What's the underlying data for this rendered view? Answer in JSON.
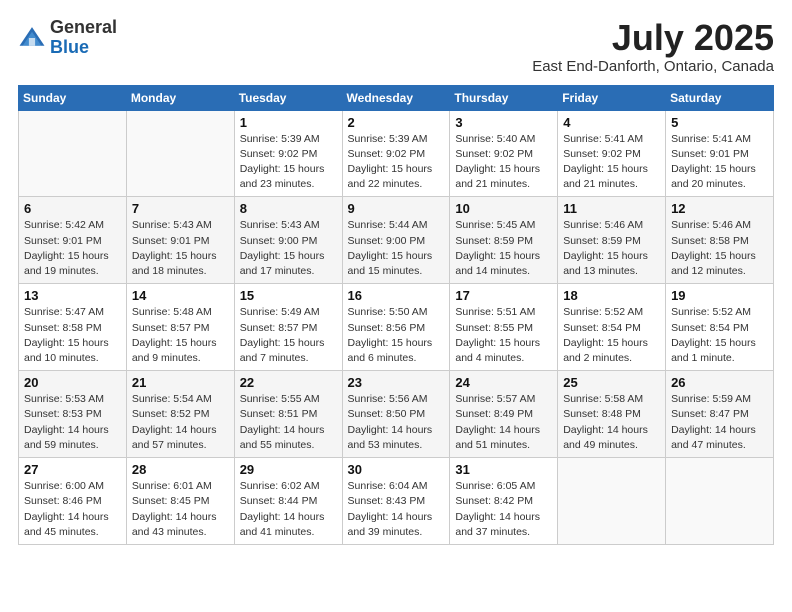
{
  "logo": {
    "general": "General",
    "blue": "Blue"
  },
  "title": "July 2025",
  "subtitle": "East End-Danforth, Ontario, Canada",
  "weekdays": [
    "Sunday",
    "Monday",
    "Tuesday",
    "Wednesday",
    "Thursday",
    "Friday",
    "Saturday"
  ],
  "weeks": [
    [
      {
        "day": "",
        "sunrise": "",
        "sunset": "",
        "daylight": ""
      },
      {
        "day": "",
        "sunrise": "",
        "sunset": "",
        "daylight": ""
      },
      {
        "day": "1",
        "sunrise": "Sunrise: 5:39 AM",
        "sunset": "Sunset: 9:02 PM",
        "daylight": "Daylight: 15 hours and 23 minutes."
      },
      {
        "day": "2",
        "sunrise": "Sunrise: 5:39 AM",
        "sunset": "Sunset: 9:02 PM",
        "daylight": "Daylight: 15 hours and 22 minutes."
      },
      {
        "day": "3",
        "sunrise": "Sunrise: 5:40 AM",
        "sunset": "Sunset: 9:02 PM",
        "daylight": "Daylight: 15 hours and 21 minutes."
      },
      {
        "day": "4",
        "sunrise": "Sunrise: 5:41 AM",
        "sunset": "Sunset: 9:02 PM",
        "daylight": "Daylight: 15 hours and 21 minutes."
      },
      {
        "day": "5",
        "sunrise": "Sunrise: 5:41 AM",
        "sunset": "Sunset: 9:01 PM",
        "daylight": "Daylight: 15 hours and 20 minutes."
      }
    ],
    [
      {
        "day": "6",
        "sunrise": "Sunrise: 5:42 AM",
        "sunset": "Sunset: 9:01 PM",
        "daylight": "Daylight: 15 hours and 19 minutes."
      },
      {
        "day": "7",
        "sunrise": "Sunrise: 5:43 AM",
        "sunset": "Sunset: 9:01 PM",
        "daylight": "Daylight: 15 hours and 18 minutes."
      },
      {
        "day": "8",
        "sunrise": "Sunrise: 5:43 AM",
        "sunset": "Sunset: 9:00 PM",
        "daylight": "Daylight: 15 hours and 17 minutes."
      },
      {
        "day": "9",
        "sunrise": "Sunrise: 5:44 AM",
        "sunset": "Sunset: 9:00 PM",
        "daylight": "Daylight: 15 hours and 15 minutes."
      },
      {
        "day": "10",
        "sunrise": "Sunrise: 5:45 AM",
        "sunset": "Sunset: 8:59 PM",
        "daylight": "Daylight: 15 hours and 14 minutes."
      },
      {
        "day": "11",
        "sunrise": "Sunrise: 5:46 AM",
        "sunset": "Sunset: 8:59 PM",
        "daylight": "Daylight: 15 hours and 13 minutes."
      },
      {
        "day": "12",
        "sunrise": "Sunrise: 5:46 AM",
        "sunset": "Sunset: 8:58 PM",
        "daylight": "Daylight: 15 hours and 12 minutes."
      }
    ],
    [
      {
        "day": "13",
        "sunrise": "Sunrise: 5:47 AM",
        "sunset": "Sunset: 8:58 PM",
        "daylight": "Daylight: 15 hours and 10 minutes."
      },
      {
        "day": "14",
        "sunrise": "Sunrise: 5:48 AM",
        "sunset": "Sunset: 8:57 PM",
        "daylight": "Daylight: 15 hours and 9 minutes."
      },
      {
        "day": "15",
        "sunrise": "Sunrise: 5:49 AM",
        "sunset": "Sunset: 8:57 PM",
        "daylight": "Daylight: 15 hours and 7 minutes."
      },
      {
        "day": "16",
        "sunrise": "Sunrise: 5:50 AM",
        "sunset": "Sunset: 8:56 PM",
        "daylight": "Daylight: 15 hours and 6 minutes."
      },
      {
        "day": "17",
        "sunrise": "Sunrise: 5:51 AM",
        "sunset": "Sunset: 8:55 PM",
        "daylight": "Daylight: 15 hours and 4 minutes."
      },
      {
        "day": "18",
        "sunrise": "Sunrise: 5:52 AM",
        "sunset": "Sunset: 8:54 PM",
        "daylight": "Daylight: 15 hours and 2 minutes."
      },
      {
        "day": "19",
        "sunrise": "Sunrise: 5:52 AM",
        "sunset": "Sunset: 8:54 PM",
        "daylight": "Daylight: 15 hours and 1 minute."
      }
    ],
    [
      {
        "day": "20",
        "sunrise": "Sunrise: 5:53 AM",
        "sunset": "Sunset: 8:53 PM",
        "daylight": "Daylight: 14 hours and 59 minutes."
      },
      {
        "day": "21",
        "sunrise": "Sunrise: 5:54 AM",
        "sunset": "Sunset: 8:52 PM",
        "daylight": "Daylight: 14 hours and 57 minutes."
      },
      {
        "day": "22",
        "sunrise": "Sunrise: 5:55 AM",
        "sunset": "Sunset: 8:51 PM",
        "daylight": "Daylight: 14 hours and 55 minutes."
      },
      {
        "day": "23",
        "sunrise": "Sunrise: 5:56 AM",
        "sunset": "Sunset: 8:50 PM",
        "daylight": "Daylight: 14 hours and 53 minutes."
      },
      {
        "day": "24",
        "sunrise": "Sunrise: 5:57 AM",
        "sunset": "Sunset: 8:49 PM",
        "daylight": "Daylight: 14 hours and 51 minutes."
      },
      {
        "day": "25",
        "sunrise": "Sunrise: 5:58 AM",
        "sunset": "Sunset: 8:48 PM",
        "daylight": "Daylight: 14 hours and 49 minutes."
      },
      {
        "day": "26",
        "sunrise": "Sunrise: 5:59 AM",
        "sunset": "Sunset: 8:47 PM",
        "daylight": "Daylight: 14 hours and 47 minutes."
      }
    ],
    [
      {
        "day": "27",
        "sunrise": "Sunrise: 6:00 AM",
        "sunset": "Sunset: 8:46 PM",
        "daylight": "Daylight: 14 hours and 45 minutes."
      },
      {
        "day": "28",
        "sunrise": "Sunrise: 6:01 AM",
        "sunset": "Sunset: 8:45 PM",
        "daylight": "Daylight: 14 hours and 43 minutes."
      },
      {
        "day": "29",
        "sunrise": "Sunrise: 6:02 AM",
        "sunset": "Sunset: 8:44 PM",
        "daylight": "Daylight: 14 hours and 41 minutes."
      },
      {
        "day": "30",
        "sunrise": "Sunrise: 6:04 AM",
        "sunset": "Sunset: 8:43 PM",
        "daylight": "Daylight: 14 hours and 39 minutes."
      },
      {
        "day": "31",
        "sunrise": "Sunrise: 6:05 AM",
        "sunset": "Sunset: 8:42 PM",
        "daylight": "Daylight: 14 hours and 37 minutes."
      },
      {
        "day": "",
        "sunrise": "",
        "sunset": "",
        "daylight": ""
      },
      {
        "day": "",
        "sunrise": "",
        "sunset": "",
        "daylight": ""
      }
    ]
  ]
}
